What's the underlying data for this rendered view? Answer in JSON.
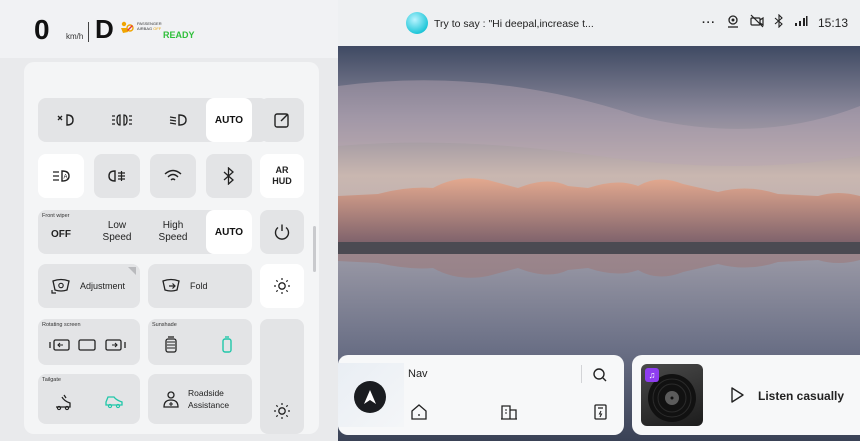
{
  "status": {
    "speed": "0",
    "speed_unit": "km/h",
    "gear": "D",
    "airbag_line1": "PASSENGER",
    "airbag_line2": "AIRBAG",
    "airbag_line3": "OFF",
    "ready": "READY"
  },
  "assistant": {
    "hint": "Try to say : \"Hi deepal,increase t...",
    "more": "···",
    "time": "15:13"
  },
  "controls": {
    "auto_1": "AUTO",
    "ar_hud": "AR\nHUD",
    "ar": "AR",
    "hud": "HUD",
    "front_wiper": "Front wiper",
    "wiper_off": "OFF",
    "wiper_low_1": "Low",
    "wiper_low_2": "Speed",
    "wiper_high_1": "High",
    "wiper_high_2": "Speed",
    "wiper_auto": "AUTO",
    "adjustment": "Adjustment",
    "fold": "Fold",
    "rotating_screen": "Rotating screen",
    "sunshade": "Sunshade",
    "tailgate": "Tailgate",
    "roadside_1": "Roadside",
    "roadside_2": "Assistance"
  },
  "nav": {
    "title": "Nav"
  },
  "music": {
    "label": "Listen casually"
  },
  "icons": [
    "fog-light-off-icon",
    "position-light-icon",
    "low-beam-icon",
    "edit-icon",
    "high-beam-icon",
    "rear-fog-icon",
    "wifi-icon",
    "bluetooth-icon",
    "power-icon",
    "mirror-adjust-icon",
    "mirror-fold-icon",
    "brightness-icon",
    "rotate-left-icon",
    "screen-icon",
    "rotate-right-icon",
    "sunshade-icon",
    "sunshade-toggle-icon",
    "tailgate-icon",
    "tailgate-car-icon",
    "roadside-assistance-icon",
    "home-icon",
    "company-icon",
    "charging-station-icon",
    "search-icon",
    "play-icon",
    "music-icon",
    "navigation-arrow-icon",
    "location-icon",
    "camera-off-icon",
    "signal-icon"
  ],
  "colors": {
    "accent_green": "#2fbf3a",
    "accent_teal": "#21c7a9",
    "music_badge": "#8e3df0"
  }
}
